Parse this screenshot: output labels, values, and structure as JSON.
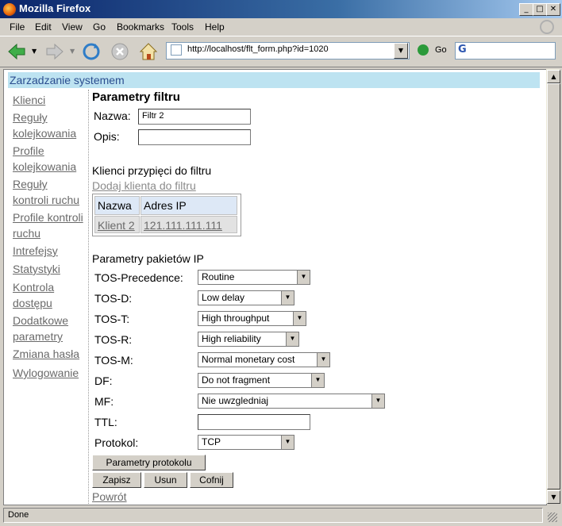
{
  "window": {
    "title": "Mozilla Firefox",
    "status": "Done"
  },
  "menu": {
    "items": [
      "File",
      "Edit",
      "View",
      "Go",
      "Bookmarks",
      "Tools",
      "Help"
    ]
  },
  "toolbar": {
    "url": "http://localhost/flt_form.php?id=1020",
    "go_label": "Go"
  },
  "page": {
    "header": "Zarzadzanie systemem",
    "nav": [
      "Klienci",
      "Reguły kolejkowania",
      "Profile kolejkowania",
      "Reguły kontroli ruchu",
      "Profile kontroli ruchu",
      "Intrefejsy",
      "Statystyki",
      "Kontrola dostępu",
      "Dodatkowe parametry",
      "Zmiana hasła",
      "Wylogowanie"
    ],
    "title": "Parametry filtru",
    "name_label": "Nazwa:",
    "name_value": "Filtr 2",
    "desc_label": "Opis:",
    "desc_value": "",
    "clients_heading": "Klienci przypięci do filtru",
    "add_client_link": "Dodaj klienta do filtru",
    "clients_table": {
      "headers": [
        "Nazwa",
        "Adres IP"
      ],
      "rows": [
        [
          "Klient 2",
          "121.111.111.111"
        ]
      ]
    },
    "ip_heading": "Parametry pakietów IP",
    "fields": {
      "tos_precedence": {
        "label": "TOS-Precedence:",
        "value": "Routine"
      },
      "tos_d": {
        "label": "TOS-D:",
        "value": "Low delay"
      },
      "tos_t": {
        "label": "TOS-T:",
        "value": "High throughput"
      },
      "tos_r": {
        "label": "TOS-R:",
        "value": "High reliability"
      },
      "tos_m": {
        "label": "TOS-M:",
        "value": "Normal monetary cost"
      },
      "df": {
        "label": "DF:",
        "value": "Do not fragment"
      },
      "mf": {
        "label": "MF:",
        "value": "Nie uwzgledniaj"
      },
      "ttl": {
        "label": "TTL:",
        "value": ""
      },
      "protocol": {
        "label": "Protokol:",
        "value": "TCP"
      }
    },
    "buttons": {
      "protocol_params": "Parametry protokolu",
      "save": "Zapisz",
      "delete": "Usun",
      "undo": "Cofnij"
    },
    "back_link": "Powrót"
  }
}
